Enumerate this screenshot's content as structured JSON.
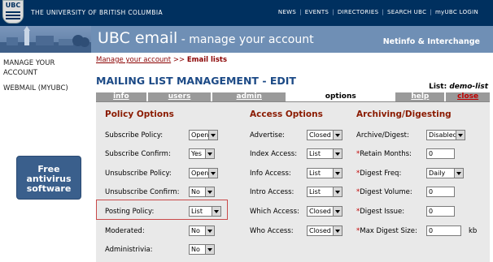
{
  "header": {
    "logo_text": "UBC",
    "university": "THE UNIVERSITY OF BRITISH COLUMBIA",
    "links": [
      "NEWS",
      "EVENTS",
      "DIRECTORIES",
      "SEARCH UBC",
      "myUBC LOGIN"
    ],
    "separator": "|"
  },
  "banner": {
    "title": "UBC email",
    "subtitle": " - manage your account",
    "right": "Netinfo & Interchange"
  },
  "sidebar": {
    "items": [
      {
        "label": "MANAGE YOUR ACCOUNT"
      },
      {
        "label": "WEBMAIL (MYUBC)"
      }
    ],
    "promo": "Free antivirus software"
  },
  "breadcrumb": {
    "crumb1": "Manage your account",
    "separator": " >> ",
    "crumb2": "Email lists"
  },
  "page_title": "MAILING LIST MANAGEMENT - EDIT",
  "list_label": "List:",
  "list_name": "demo-list",
  "tabs": [
    {
      "label": "info",
      "active": false
    },
    {
      "label": "users",
      "active": false
    },
    {
      "label": "admin",
      "active": false
    },
    {
      "label": "options",
      "active": true
    },
    {
      "label": "help",
      "active": false
    },
    {
      "label": "close",
      "active": false
    }
  ],
  "policy": {
    "title": "Policy Options",
    "fields": [
      {
        "label": "Subscribe Policy:",
        "value": "Open"
      },
      {
        "label": "Subscribe Confirm:",
        "value": "Yes"
      },
      {
        "label": "Unsubscribe Policy:",
        "value": "Open"
      },
      {
        "label": "Unsubscribe Confirm:",
        "value": "No"
      },
      {
        "label": "Posting Policy:",
        "value": "List"
      },
      {
        "label": "Moderated:",
        "value": "No"
      },
      {
        "label": "Administrivia:",
        "value": "No"
      }
    ]
  },
  "access": {
    "title": "Access Options",
    "fields": [
      {
        "label": "Advertise:",
        "value": "Closed"
      },
      {
        "label": "Index Access:",
        "value": "List"
      },
      {
        "label": "Info Access:",
        "value": "List"
      },
      {
        "label": "Intro Access:",
        "value": "List"
      },
      {
        "label": "Which Access:",
        "value": "Closed"
      },
      {
        "label": "Who Access:",
        "value": "Closed"
      }
    ]
  },
  "archiving": {
    "title": "Archiving/Digesting",
    "fields": [
      {
        "label": "Archive/Digest:",
        "required": "",
        "value": "Disabled",
        "type": "select"
      },
      {
        "label": "Retain Months:",
        "required": "*",
        "value": "0",
        "type": "text"
      },
      {
        "label": "Digest Freq:",
        "required": "*",
        "value": "Daily",
        "type": "select"
      },
      {
        "label": "Digest Volume:",
        "required": "*",
        "value": "0",
        "type": "text"
      },
      {
        "label": "Digest Issue:",
        "required": "*",
        "value": "0",
        "type": "text"
      },
      {
        "label": "Max Digest Size:",
        "required": "*",
        "value": "0",
        "type": "text",
        "unit": "kb"
      }
    ]
  }
}
